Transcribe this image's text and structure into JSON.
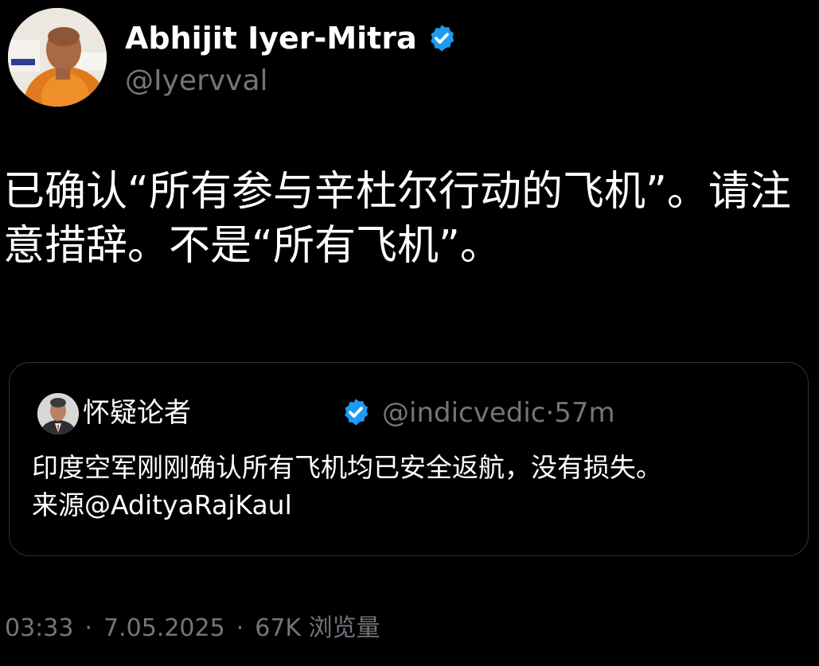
{
  "author": {
    "display_name": "Abhijit Iyer-Mitra",
    "handle": "@Iyervval",
    "avatar_icon": "user-avatar",
    "verified_icon": "verified-badge-icon"
  },
  "tweet": {
    "text": "已确认“所有参与辛杜尔行动的飞机”。请注意措辞。不是“所有飞机”。"
  },
  "quoted_tweet": {
    "display_name": "怀疑论者",
    "handle": "@indicvedic",
    "separator": "·",
    "time": "57m",
    "text_line1": "印度空军刚刚确认所有飞机均已安全返航，没有损失。",
    "text_line2": "来源@AdityaRajKaul"
  },
  "footer": {
    "time": "03:33",
    "date": "7.05.2025",
    "views_count": "67K",
    "views_label": "浏览量",
    "separator": "·"
  },
  "colors": {
    "background": "#000000",
    "primary_text": "#ffffff",
    "secondary_text": "#71767b",
    "verified_blue": "#1d9bf0",
    "card_border": "#2f3336"
  }
}
